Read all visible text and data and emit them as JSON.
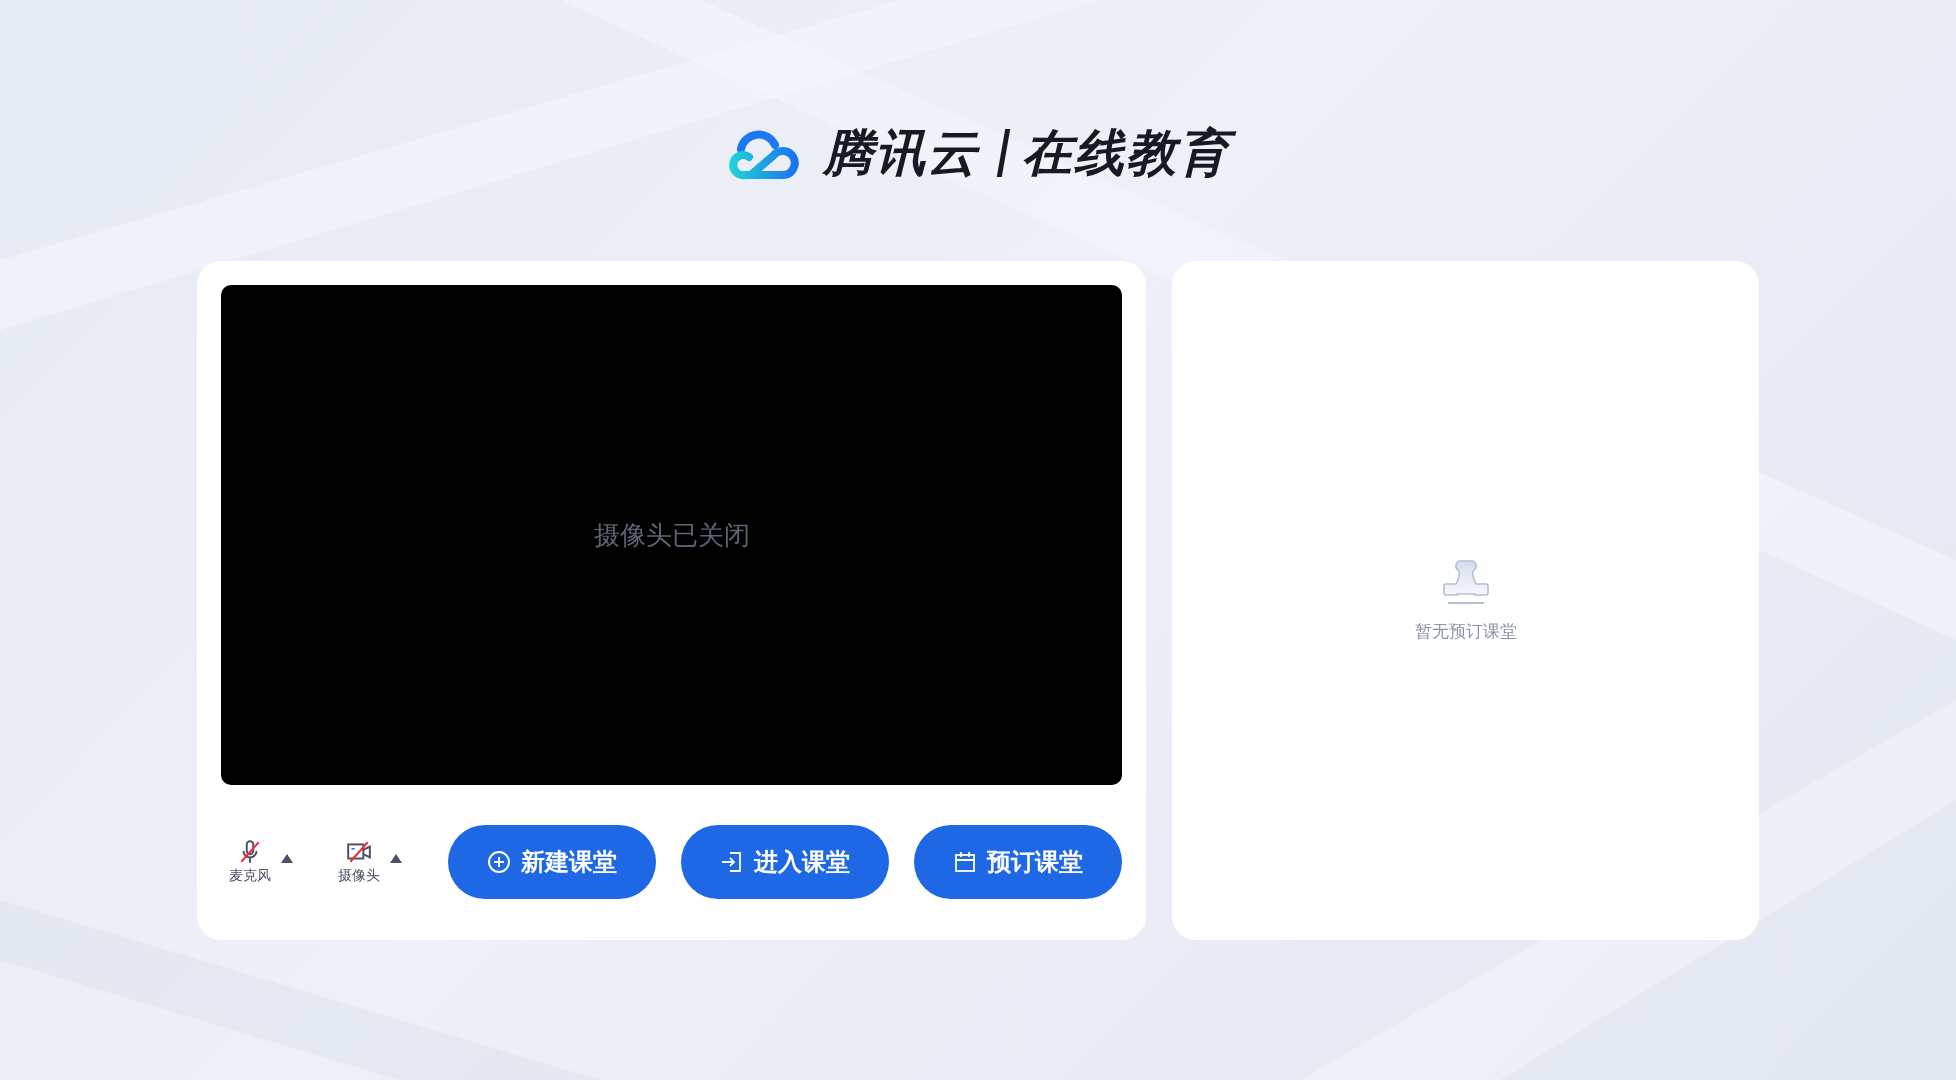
{
  "brand": {
    "name": "腾讯云",
    "product": "在线教育"
  },
  "preview": {
    "message": "摄像头已关闭"
  },
  "devices": [
    {
      "kind": "mic",
      "label": "麦克风",
      "muted": true
    },
    {
      "kind": "camera",
      "label": "摄像头",
      "muted": true
    }
  ],
  "actions": [
    {
      "kind": "create",
      "label": "新建课堂"
    },
    {
      "kind": "join",
      "label": "进入课堂"
    },
    {
      "kind": "schedule",
      "label": "预订课堂"
    }
  ],
  "schedule": {
    "empty_text": "暂无预订课堂"
  }
}
